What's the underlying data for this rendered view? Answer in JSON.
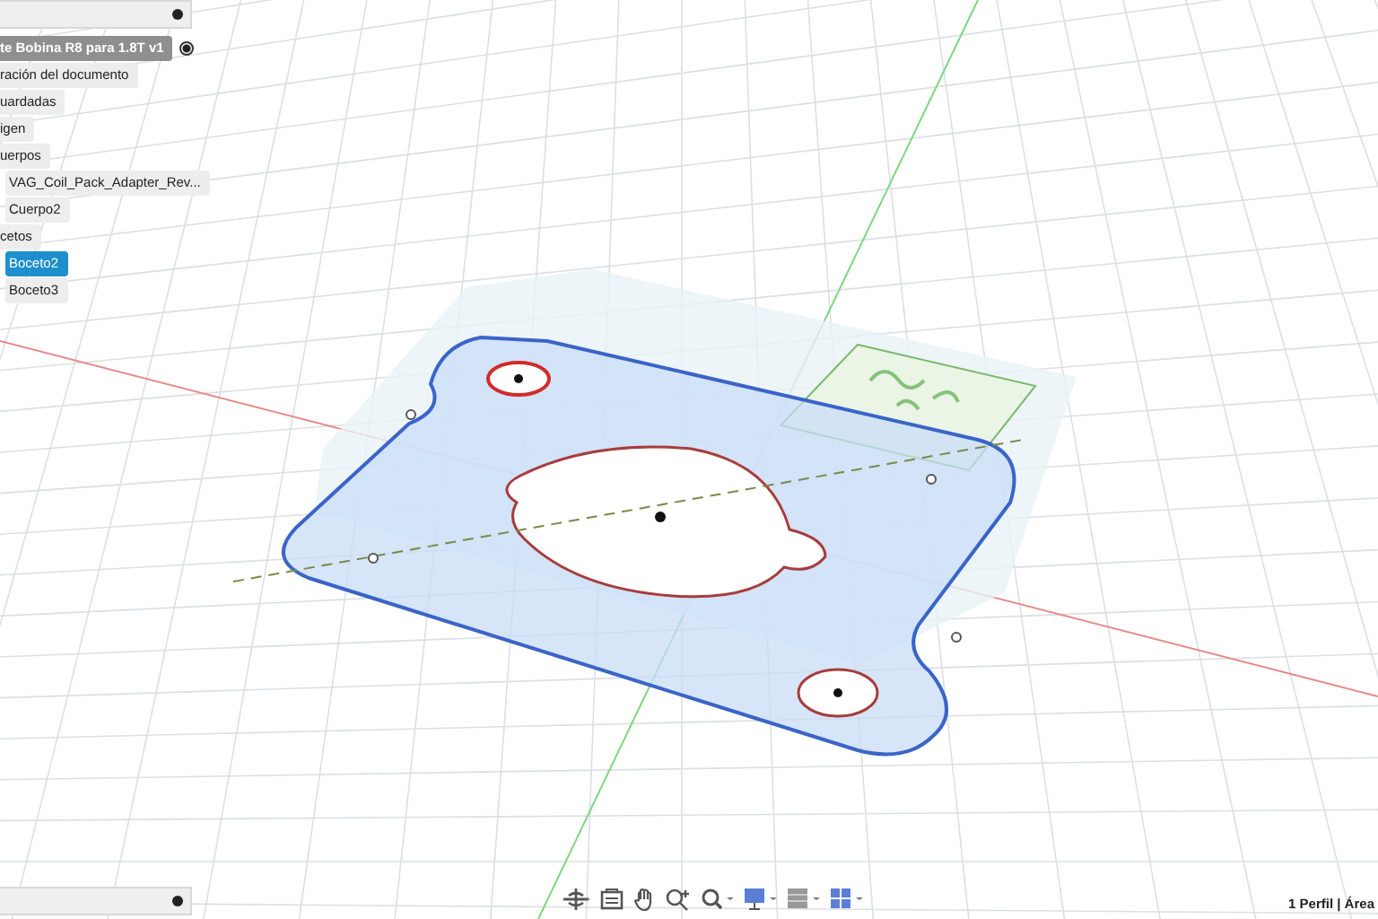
{
  "browser": {
    "root": {
      "label": "te Bobina R8 para 1.8T v1",
      "active": true
    },
    "items": [
      {
        "label": "ración del documento",
        "selected": false
      },
      {
        "label": "uardadas",
        "selected": false
      },
      {
        "label": "igen",
        "selected": false
      },
      {
        "label": "uerpos",
        "selected": false,
        "children": [
          {
            "label": "VAG_Coil_Pack_Adapter_Rev...",
            "selected": false
          },
          {
            "label": "Cuerpo2",
            "selected": false
          }
        ]
      },
      {
        "label": "cetos",
        "selected": false,
        "children": [
          {
            "label": "Boceto2",
            "selected": true
          },
          {
            "label": "Boceto3",
            "selected": false
          }
        ]
      }
    ]
  },
  "status_bar": {
    "text": "1 Perfil | Área"
  }
}
